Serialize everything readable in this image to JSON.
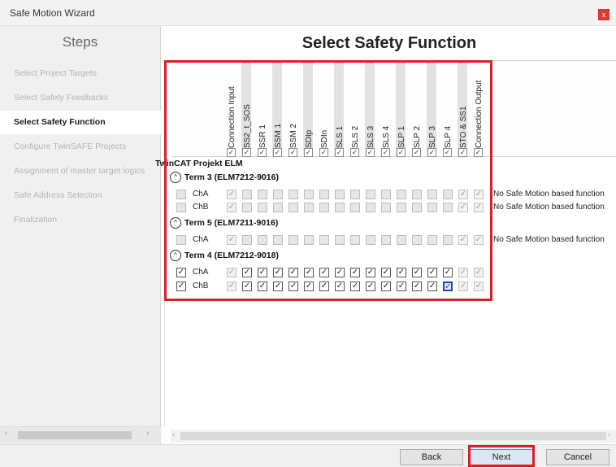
{
  "window": {
    "title": "Safe Motion Wizard",
    "close_label": "x"
  },
  "sidebar": {
    "header": "Steps",
    "steps": [
      {
        "label": "Select Project Targets",
        "active": false
      },
      {
        "label": "Select Safety Feedbacks",
        "active": false
      },
      {
        "label": "Select Safety Function",
        "active": true
      },
      {
        "label": "Configure TwinSAFE Projects",
        "active": false
      },
      {
        "label": "Assignment of master target logics",
        "active": false
      },
      {
        "label": "Safe Address Selection",
        "active": false
      },
      {
        "label": "Finalization",
        "active": false
      }
    ]
  },
  "main": {
    "title": "Select Safety Function",
    "columns": [
      "Connection Input",
      "SS2_t_SOS",
      "SSR 1",
      "SSM 1",
      "SSM 2",
      "SDIp",
      "SDIn",
      "SLS 1",
      "SLS 2",
      "SLS 3",
      "SLS 4",
      "SLP 1",
      "SLP 2",
      "SLP 3",
      "SLP 4",
      "STO & SS1",
      "Connection Output"
    ],
    "project": "TwinCAT Projekt ELM",
    "terms": [
      {
        "name": "Term 3 (ELM7212-9016)",
        "toggle": "^",
        "channels": [
          {
            "name": "ChA",
            "checked": false,
            "note": "No Safe Motion based function"
          },
          {
            "name": "ChB",
            "checked": false,
            "note": "No Safe Motion based function"
          }
        ]
      },
      {
        "name": "Term 5 (ELM7211-9016)",
        "toggle": "^",
        "channels": [
          {
            "name": "ChA",
            "checked": false,
            "note": "No Safe Motion based function"
          }
        ]
      },
      {
        "name": "Term 4 (ELM7212-9018)",
        "toggle": "^",
        "channels": [
          {
            "name": "ChA",
            "checked": true,
            "note": ""
          },
          {
            "name": "ChB",
            "checked": true,
            "note": ""
          }
        ]
      }
    ]
  },
  "footer": {
    "back_label": "Back",
    "next_label": "Next",
    "cancel_label": "Cancel"
  },
  "colors": {
    "highlight": "#d9202a",
    "focus": "#1a47c8"
  },
  "icons": {
    "check": "✓",
    "left_arrow": "‹",
    "right_arrow": "›"
  }
}
